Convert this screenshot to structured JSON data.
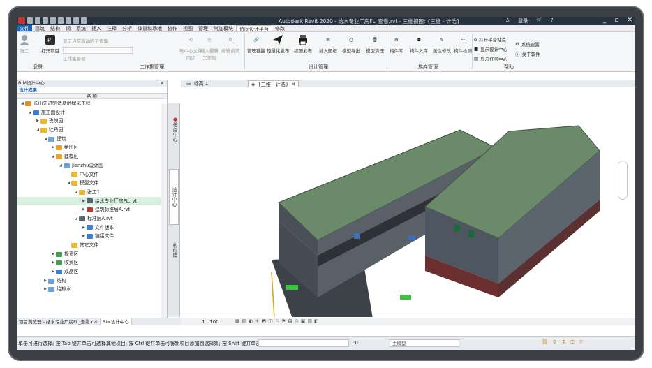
{
  "app": {
    "title": "Autodesk Revit 2020 - 给水专业厂房FL_查看.rvt - 三维视图: {三维 - 计浩}",
    "login": "登录",
    "help_icon": "?"
  },
  "menu": [
    "文件",
    "建筑",
    "结构",
    "钢",
    "系统",
    "插入",
    "注释",
    "分析",
    "体量和场地",
    "协作",
    "视图",
    "管理",
    "附加模块",
    "协同设计平台",
    "修改"
  ],
  "ribbon": {
    "login_group": {
      "label": "登录",
      "user_btn": "张工"
    },
    "worksets": {
      "label": "工作集管理",
      "open_project": "打开项目",
      "workset_mgr": "工作集管理",
      "show_active": "显示当前活动的工作集",
      "sync": "与中心文件\n同步",
      "load_latest": "载入最新\n工作集",
      "check_request": "编辑请求",
      "refresh": "刷新"
    },
    "design": {
      "label": "设计管理",
      "items": [
        "管理链接",
        "轻量化发布",
        "视图发布",
        "插入图框",
        "模型导出",
        "模型清理"
      ]
    },
    "family": {
      "label": "族库管理",
      "items": [
        "构件库",
        "构件入库",
        "属性修改",
        "构件检测"
      ]
    },
    "help": {
      "label": "帮助",
      "open_site": "打开平台站点",
      "show_center": "显示设计中心",
      "show_tasks": "显示任务中心",
      "sys_settings": "系统设置",
      "about": "关于软件"
    }
  },
  "left_panel": {
    "header": "BIM设计中心",
    "tab": "设计成果",
    "col": "名 称",
    "tree": [
      {
        "label": "长山先进制造基地绿化工程",
        "lvl": 0,
        "tw": "◢",
        "ic": "#e0912c"
      },
      {
        "label": "施工图设计",
        "lvl": 1,
        "tw": "◢",
        "ic": "#3f7fd1"
      },
      {
        "label": "玫瑰园",
        "lvl": 2,
        "tw": "▶",
        "ic": "#e8b92e"
      },
      {
        "label": "牡丹园",
        "lvl": 2,
        "tw": "◢",
        "ic": "#e8b92e"
      },
      {
        "label": "建筑",
        "lvl": 3,
        "tw": "◢",
        "ic": "#6aa3d8"
      },
      {
        "label": "给图区",
        "lvl": 4,
        "tw": "▶",
        "ic": "#e8a12e"
      },
      {
        "label": "建模区",
        "lvl": 4,
        "tw": "◢",
        "ic": "#e8a12e"
      },
      {
        "label": "Jianzhu设计图",
        "lvl": 5,
        "tw": "◢",
        "ic": "#6aa3d8"
      },
      {
        "label": "中心文件",
        "lvl": 6,
        "tw": "",
        "ic": "#e8b92e"
      },
      {
        "label": "模型文件",
        "lvl": 6,
        "tw": "◢",
        "ic": "#e8b92e"
      },
      {
        "label": "张工1",
        "lvl": 7,
        "tw": "◢",
        "ic": "#e8b92e"
      },
      {
        "label": "给水专业厂房FL.rvt",
        "lvl": 8,
        "tw": "▶",
        "ic": "#5b6770",
        "sel": true
      },
      {
        "label": "建筑标准层A.rvt",
        "lvl": 8,
        "tw": "▶",
        "ic": "#c0392b"
      },
      {
        "label": "标准层A.rvt",
        "lvl": 7,
        "tw": "◢",
        "ic": "#5b6770"
      },
      {
        "label": "文件版本",
        "lvl": 8,
        "tw": "▶",
        "ic": "#3f7fd1"
      },
      {
        "label": "链接文件",
        "lvl": 8,
        "tw": "▶",
        "ic": "#3f7fd1"
      },
      {
        "label": "其它文件",
        "lvl": 6,
        "tw": "",
        "ic": "#e8b92e"
      },
      {
        "label": "提资区",
        "lvl": 4,
        "tw": "▶",
        "ic": "#4a9a57"
      },
      {
        "label": "收资区",
        "lvl": 4,
        "tw": "▶",
        "ic": "#4a9a57"
      },
      {
        "label": "成品区",
        "lvl": 4,
        "tw": "▶",
        "ic": "#3f7fd1"
      },
      {
        "label": "结构",
        "lvl": 3,
        "tw": "▶",
        "ic": "#6aa3d8"
      },
      {
        "label": "给排水",
        "lvl": 3,
        "tw": "▶",
        "ic": "#6aa3d8"
      }
    ]
  },
  "side_tabs": [
    "任务中心",
    "设计中心",
    "构件库"
  ],
  "view_tabs": [
    "标高 1",
    "{三维 - 计浩}"
  ],
  "view_scale": "1 : 100",
  "bottom_tabs": [
    "项目浏览器 - 给水专业厂房FL_查看.rvt",
    "BIM设计中心"
  ],
  "status": {
    "message": "单击可进行选择; 按 Tab 键并单击可选择其他项目; 按 Ctrl 键并单击可将新项目添加到选择集; 按 Shift 键并单击",
    "field": ":0",
    "model": "主模型"
  },
  "colors": {
    "titlebar": "#26323d",
    "file_tab": "#1f63b5",
    "roof": "#6b8a6a",
    "walls": "#4e5661"
  },
  "cube_label": "右"
}
